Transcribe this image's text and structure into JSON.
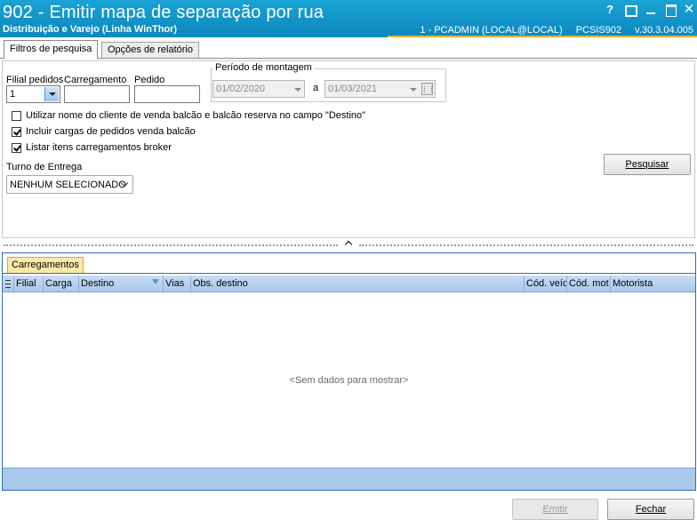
{
  "titlebar": {
    "title": "902 - Emitir mapa de separação por rua",
    "subtitle": "Distribuição e Varejo (Linha WinThor)",
    "user_info": "1 - PCADMIN (LOCAL@LOCAL)",
    "program": "PCSIS902",
    "version": "v.30.3.04.005",
    "help_glyph": "?",
    "close_glyph": "✕",
    "accent_color": "#e8b130",
    "bar_color": "#0c87bd"
  },
  "tabs": [
    {
      "label": "Filtros de pesquisa",
      "active": true
    },
    {
      "label": "Opções de relatório",
      "active": false
    }
  ],
  "filters": {
    "filial_label": "Filial pedidos",
    "filial_value": "1",
    "carregamento_label": "Carregamento",
    "carregamento_value": "",
    "pedido_label": "Pedido",
    "pedido_value": "",
    "periodo_label": "Período de montagem",
    "date_from": "01/02/2020",
    "date_separator": "a",
    "date_to": "01/03/2021",
    "checkboxes": [
      {
        "label": "Utilizar nome do cliente de venda balcão e balcão reserva no campo \"Destino\"",
        "checked": false
      },
      {
        "label": "Incluir cargas de pedidos venda balcão",
        "checked": true
      },
      {
        "label": "Listar itens carregamentos broker",
        "checked": true
      }
    ],
    "turno_label": "Turno de Entrega",
    "turno_value": "NENHUM SELECIONADO",
    "search_button_label": "Pesquisar"
  },
  "grid": {
    "tab_label": "Carregamentos",
    "columns": [
      "Filial",
      "Carga",
      "Destino",
      "Vias",
      "Obs. destino",
      "Cód. veíc",
      "Cód. mot",
      "Motorista"
    ],
    "empty_text": "<Sem dados para mostrar>",
    "header_color": "#a9c8ec",
    "border_color": "#2a6fbf"
  },
  "footer": {
    "emitir_label": "Emitir",
    "emitir_enabled": false,
    "fechar_label": "Fechar"
  }
}
